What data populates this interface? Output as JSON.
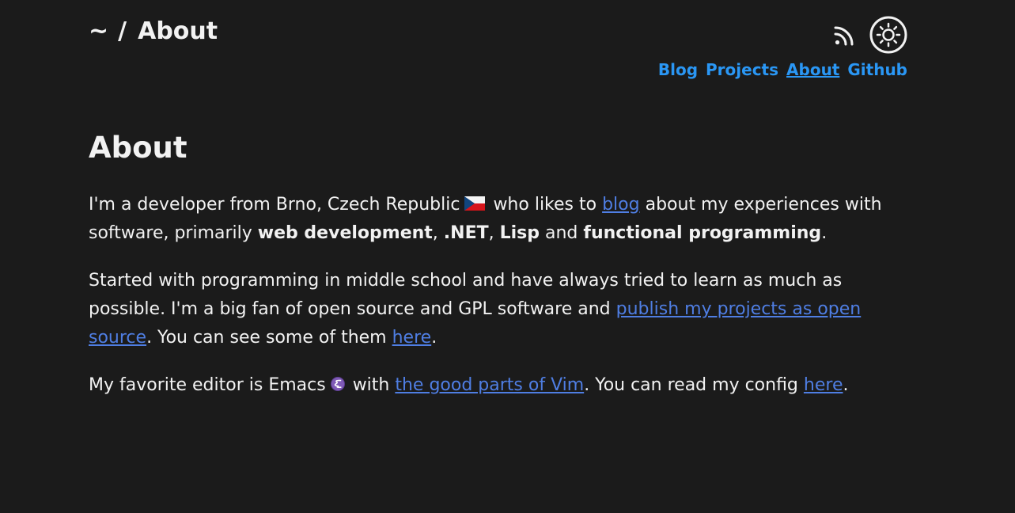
{
  "header": {
    "tilde": "~",
    "separator": "/",
    "title": "About",
    "icons": {
      "rss": "rss-icon",
      "theme": "sun-icon"
    },
    "nav": [
      {
        "label": "Blog",
        "active": false
      },
      {
        "label": "Projects",
        "active": false
      },
      {
        "label": "About",
        "active": true
      },
      {
        "label": "Github",
        "active": false
      }
    ]
  },
  "main": {
    "title": "About",
    "p1": {
      "t1": "I'm a developer from Brno, Czech Republic",
      "flag": "czech-flag-icon",
      "t2": "who likes to ",
      "link_blog": "blog",
      "t3": " about my experiences with software, primarily ",
      "b1": "web development",
      "t4": ", ",
      "b2": ".NET",
      "t5": ", ",
      "b3": "Lisp",
      "t6": " and ",
      "b4": "functional programming",
      "t7": "."
    },
    "p2": {
      "t1": "Started with programming in middle school and have always tried to learn as much as possible. I'm a big fan of open source and GPL software and ",
      "link_projects": "publish my projects as open source",
      "t2": ". You can see some of them ",
      "link_here": "here",
      "t3": "."
    },
    "p3": {
      "t1": "My favorite editor is Emacs",
      "emacs": "emacs-icon",
      "t2": "with ",
      "link_vim": "the good parts of Vim",
      "t3": ". You can read my config ",
      "link_here": "here",
      "t4": "."
    }
  },
  "colors": {
    "background": "#1b1b1b",
    "text": "#f2f2f2",
    "nav_link": "#2a97f5",
    "content_link": "#4f7ee3"
  }
}
